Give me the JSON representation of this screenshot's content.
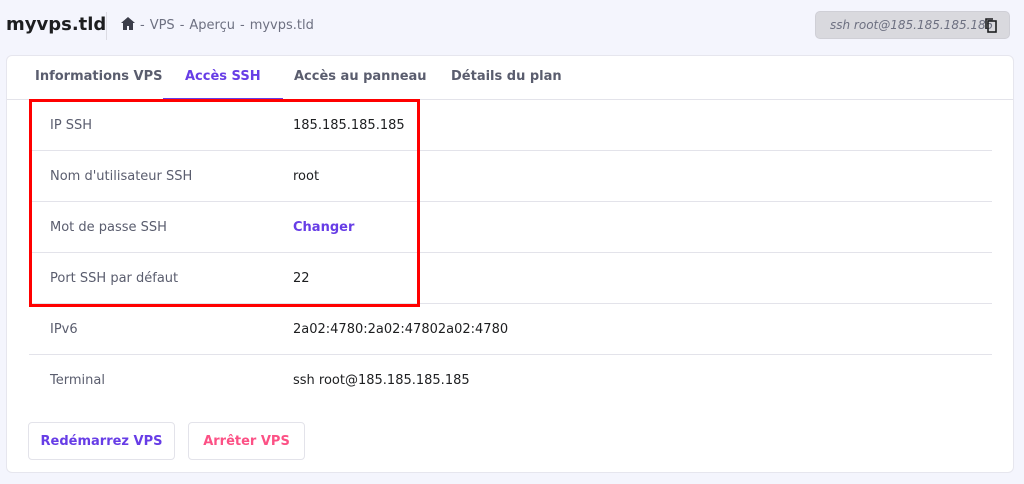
{
  "header": {
    "title": "myvps.tld",
    "breadcrumb": [
      "VPS",
      "Aperçu",
      "myvps.tld"
    ],
    "ssh_command": "ssh root@185.185.185.185"
  },
  "tabs": [
    {
      "label": "Informations VPS"
    },
    {
      "label": "Accès SSH"
    },
    {
      "label": "Accès au panneau"
    },
    {
      "label": "Détails du plan"
    }
  ],
  "rows": [
    {
      "label": "IP SSH",
      "value": "185.185.185.185"
    },
    {
      "label": "Nom d'utilisateur SSH",
      "value": "root"
    },
    {
      "label": "Mot de passe SSH",
      "value": "Changer"
    },
    {
      "label": "Port SSH par défaut",
      "value": "22"
    },
    {
      "label": "IPv6",
      "value": "2a02:4780:2a02:47802a02:4780"
    },
    {
      "label": "Terminal",
      "value": "ssh root@185.185.185.185"
    }
  ],
  "buttons": {
    "restart": "Redémarrez VPS",
    "stop": "Arrêter VPS"
  },
  "colors": {
    "accent": "#673de6",
    "danger": "#fc5185",
    "highlight": "#ff0000"
  }
}
